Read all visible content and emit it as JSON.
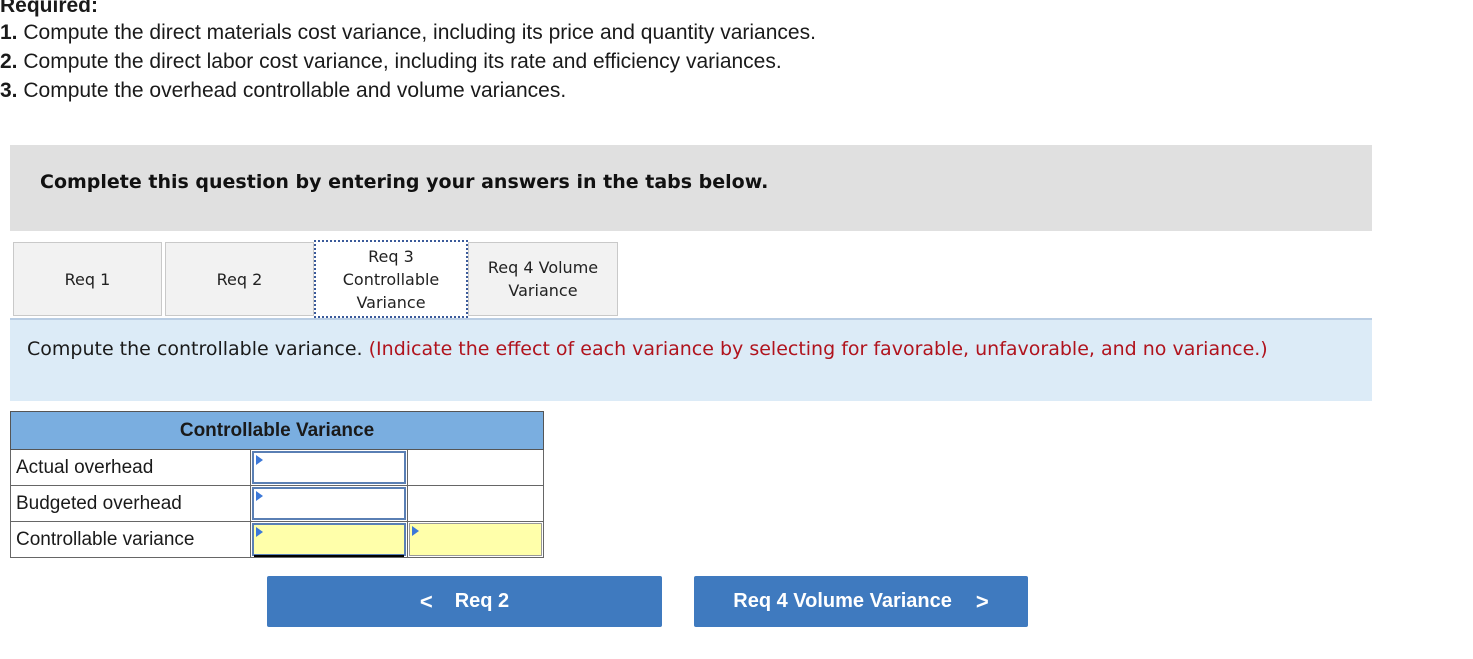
{
  "required": {
    "title": "Required:",
    "items": [
      {
        "num": "1.",
        "text": " Compute the direct materials cost variance, including its price and quantity variances."
      },
      {
        "num": "2.",
        "text": " Compute the direct labor cost variance, including its rate and efficiency variances."
      },
      {
        "num": "3.",
        "text": " Compute the overhead controllable and volume variances."
      }
    ]
  },
  "banner": {
    "text": "Complete this question by entering your answers in the tabs below."
  },
  "tabs": [
    {
      "label": "Req 1",
      "active": false
    },
    {
      "label": "Req 2",
      "active": false
    },
    {
      "label": "Req 3 Controllable Variance",
      "line1": "Req 3",
      "line2": "Controllable",
      "line3": "Variance",
      "active": true
    },
    {
      "label": "Req 4 Volume Variance",
      "line1": "Req 4 Volume",
      "line2": "Variance",
      "active": false
    }
  ],
  "instruction": {
    "main": "Compute the controllable variance. ",
    "note": "(Indicate the effect of each variance by selecting for favorable, unfavorable, and no variance.)"
  },
  "table": {
    "header": "Controllable Variance",
    "rows": [
      {
        "label": "Actual overhead",
        "value": "",
        "effect": null
      },
      {
        "label": "Budgeted overhead",
        "value": "",
        "effect": null
      },
      {
        "label": "Controllable variance",
        "value": "",
        "effect": ""
      }
    ]
  },
  "nav": {
    "prev": {
      "label": "Req 2",
      "icon": "chevron-left-icon",
      "glyph": "<"
    },
    "next": {
      "label": "Req 4 Volume Variance",
      "icon": "chevron-right-icon",
      "glyph": ">"
    }
  },
  "colors": {
    "accent_button": "#3f7abf",
    "table_header": "#7aaee0",
    "instruction_bg": "#dcebf7",
    "note_red": "#b0131d",
    "answer_yellow": "#ffffaa"
  }
}
